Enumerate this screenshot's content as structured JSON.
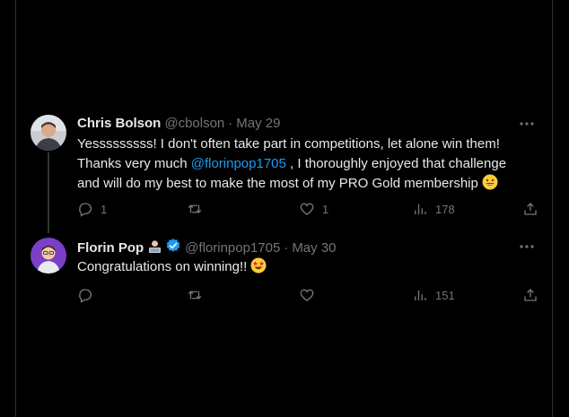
{
  "reply1": {
    "name": "Chris Bolson",
    "handle": "@cbolson",
    "date": "May 29",
    "text_before": "Yesssssssss!  I don't often take part in competitions, let alone win them!",
    "text_thanks": "Thanks very much ",
    "mention": "@florinpop1705",
    "text_after": " , I thoroughly enjoyed that challenge",
    "text_last": "and will do my best to make the most of my PRO Gold membership",
    "actions": {
      "replies": "1",
      "retweets": "",
      "likes": "1",
      "views": "178"
    }
  },
  "reply2": {
    "name": "Florin Pop",
    "handle": "@florinpop1705",
    "date": "May 30",
    "text": "Congratulations on winning!!",
    "actions": {
      "replies": "",
      "retweets": "",
      "likes": "",
      "views": "151"
    }
  },
  "icons": {
    "reply": "reply-icon",
    "retweet": "retweet-icon",
    "like": "heart-icon",
    "views": "views-icon",
    "share": "share-icon",
    "more": "more-icon",
    "verified": "verified-badge-icon"
  },
  "colors": {
    "background": "#000000",
    "text": "#e7e9ea",
    "muted": "#71767b",
    "link": "#1d9bf0",
    "verified": "#1d9bf0"
  }
}
